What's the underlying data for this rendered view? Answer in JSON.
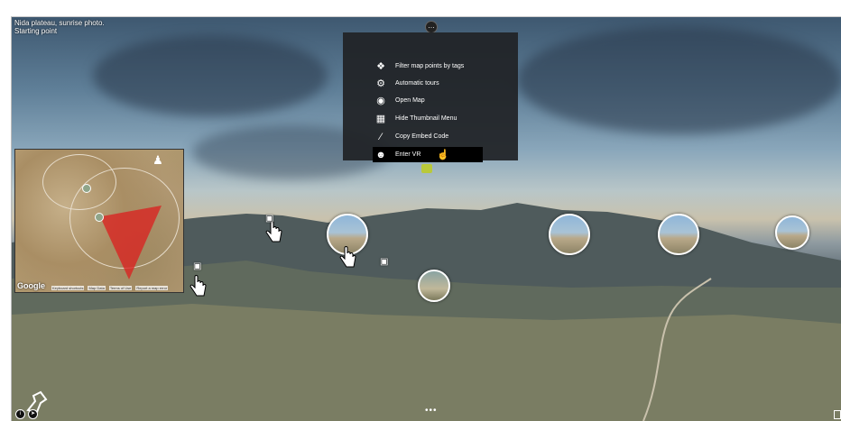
{
  "scene": {
    "title_line1": "Nida plateau, sunrise photo.",
    "title_line2": "Starting point"
  },
  "menu": {
    "items": [
      {
        "label": "Filter map points by tags",
        "icon": "tag-icon"
      },
      {
        "label": "Automatic tours",
        "icon": "tours-icon"
      },
      {
        "label": "Open Map",
        "icon": "globe-icon"
      },
      {
        "label": "Hide Thumbnail Menu",
        "icon": "thumbnail-icon"
      },
      {
        "label": "Copy Embed Code",
        "icon": "code-icon"
      },
      {
        "label": "Enter VR",
        "icon": "vr-icon"
      }
    ],
    "active_item": "Enter VR"
  },
  "map": {
    "brand": "Google",
    "attribution": [
      "Keyboard shortcuts",
      "Map Data",
      "Terms of Use",
      "Report a map error"
    ]
  },
  "thumbnails": [
    "panorama-1",
    "panorama-2",
    "panorama-3",
    "panorama-4",
    "panorama-5"
  ],
  "bottom_nav": "•••",
  "colors": {
    "menu_bg": "#202226",
    "map_polygon": "#dc1e1e",
    "status_indicator": "#b9c93a"
  }
}
